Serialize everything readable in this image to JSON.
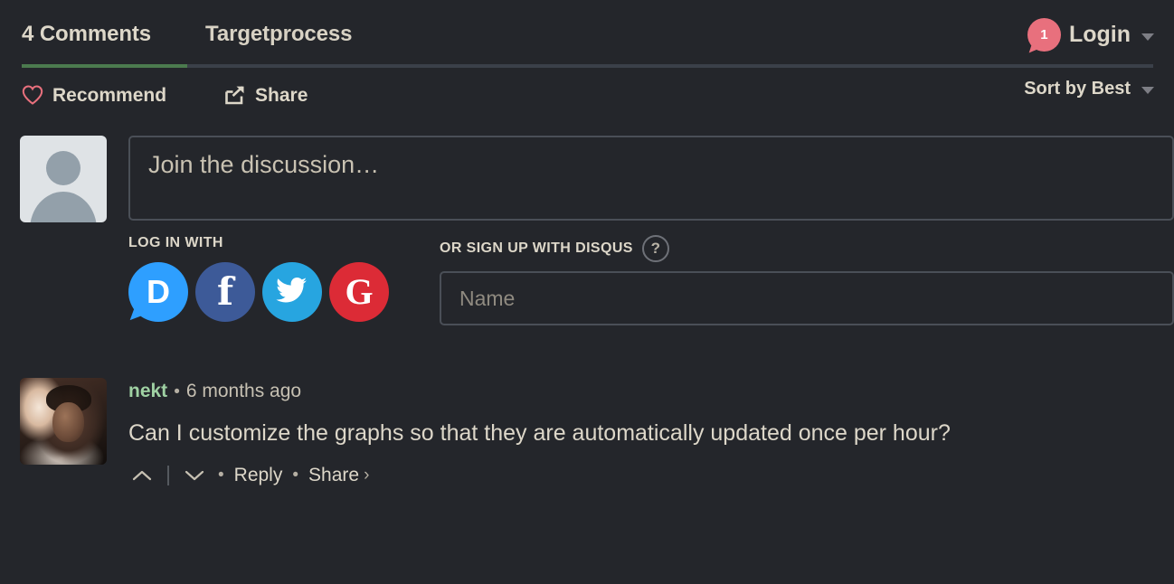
{
  "header": {
    "tabs": [
      {
        "label": "4 Comments",
        "active": true
      },
      {
        "label": "Targetprocess",
        "active": false
      }
    ],
    "login": {
      "badge_count": "1",
      "label": "Login",
      "caret_icon": "chevron-down-icon"
    }
  },
  "actionbar": {
    "recommend": {
      "label": "Recommend",
      "icon": "heart-icon",
      "color": "#e8707d"
    },
    "share": {
      "label": "Share",
      "icon": "share-export-icon"
    },
    "sort": {
      "label": "Sort by Best",
      "caret_icon": "chevron-down-icon"
    }
  },
  "composer": {
    "avatar_icon": "default-avatar-icon",
    "placeholder": "Join the discussion…"
  },
  "auth": {
    "login_with_caption": "LOG IN WITH",
    "providers": [
      {
        "name": "disqus",
        "glyph": "D",
        "color": "#2e9fff"
      },
      {
        "name": "facebook",
        "glyph": "f",
        "color": "#3d5a98"
      },
      {
        "name": "twitter",
        "glyph": "twitter-bird-icon",
        "color": "#27a5e0"
      },
      {
        "name": "google",
        "glyph": "G",
        "color": "#dc2b36"
      }
    ],
    "signup_caption": "OR SIGN UP WITH DISQUS",
    "help_glyph": "?",
    "name_placeholder": "Name",
    "name_value": ""
  },
  "comments": [
    {
      "author": "nekt",
      "separator": "•",
      "timestamp": "6 months ago",
      "text": "Can I customize the graphs so that they are automatically updated once per hour?",
      "actions": {
        "upvote_icon": "chevron-up-icon",
        "downvote_icon": "chevron-down-icon",
        "dot": "•",
        "reply": "Reply",
        "share": "Share",
        "share_caret": "›"
      }
    }
  ],
  "colors": {
    "background": "#24262b",
    "text": "#ddd7c9",
    "accent_green": "#4b7a4e",
    "author_green": "#9fd1a3",
    "badge_pink": "#e8707d",
    "border": "#4a4f57"
  }
}
